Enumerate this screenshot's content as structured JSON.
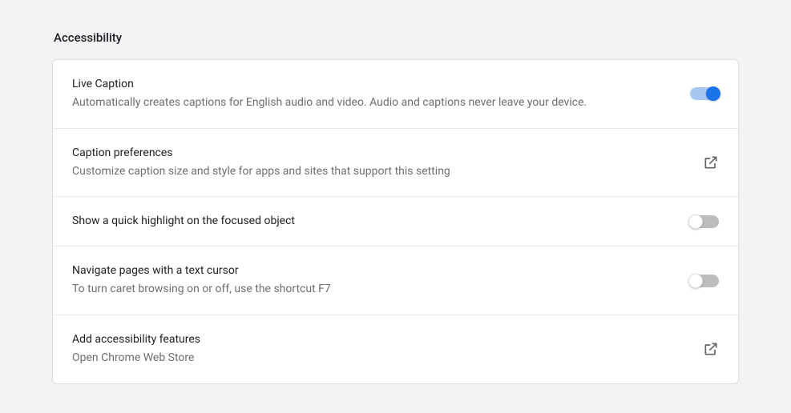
{
  "section": {
    "title": "Accessibility"
  },
  "rows": {
    "live_caption": {
      "label": "Live Caption",
      "desc": "Automatically creates captions for English audio and video. Audio and captions never leave your device."
    },
    "caption_prefs": {
      "label": "Caption preferences",
      "desc": "Customize caption size and style for apps and sites that support this setting"
    },
    "quick_highlight": {
      "label": "Show a quick highlight on the focused object"
    },
    "caret_browsing": {
      "label": "Navigate pages with a text cursor",
      "desc": "To turn caret browsing on or off, use the shortcut F7"
    },
    "add_features": {
      "label": "Add accessibility features",
      "desc": "Open Chrome Web Store"
    }
  }
}
